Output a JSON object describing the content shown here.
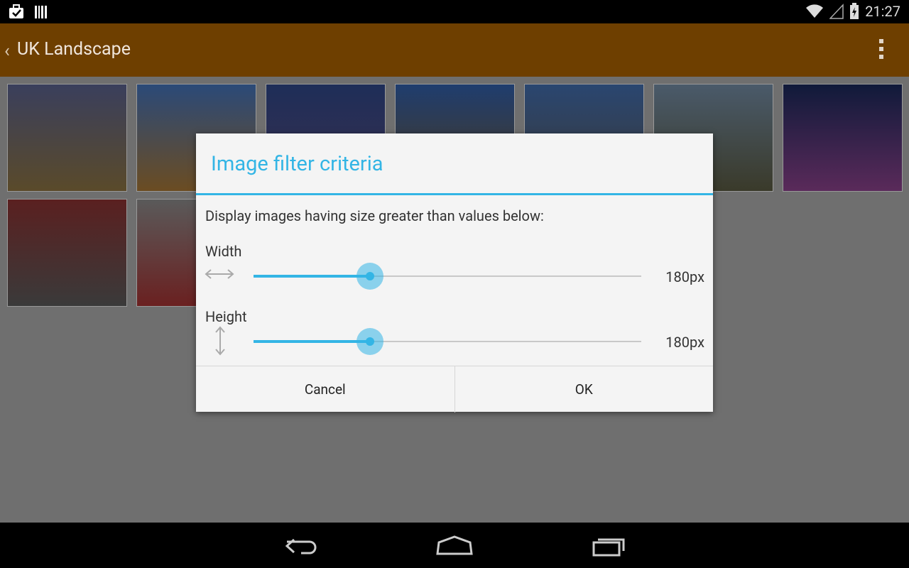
{
  "status_bar": {
    "time": "21:27"
  },
  "app_bar": {
    "title": "UK Landscape"
  },
  "dialog": {
    "title": "Image filter criteria",
    "description": "Display images having size greater than values below:",
    "width": {
      "label": "Width",
      "value": "180px",
      "slider_fraction": 0.3
    },
    "height": {
      "label": "Height",
      "value": "180px",
      "slider_fraction": 0.3
    },
    "cancel_label": "Cancel",
    "ok_label": "OK"
  },
  "colors": {
    "accent": "#33b5e5",
    "appbar": "#6e3f00"
  }
}
